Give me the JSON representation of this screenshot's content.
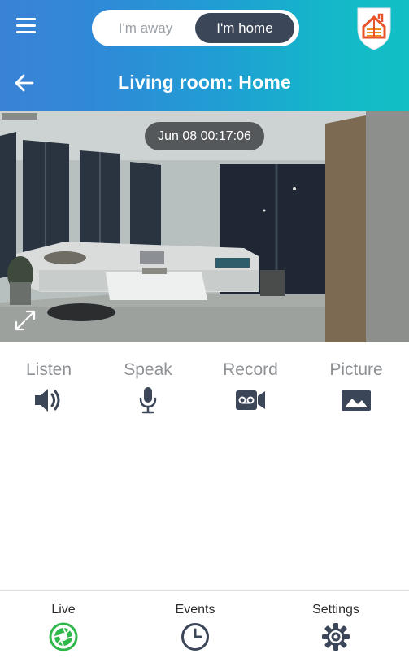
{
  "header": {
    "mode_toggle": {
      "away_label": "I'm away",
      "home_label": "I'm home",
      "selected": "home"
    },
    "title": "Living room: Home",
    "colors": {
      "gradient_start": "#3a82d6",
      "gradient_end": "#12bfc4",
      "toggle_active": "#3c4659"
    }
  },
  "camera": {
    "timestamp": "Jun 08 00:17:06"
  },
  "actions": [
    {
      "label": "Listen",
      "icon": "speaker-icon"
    },
    {
      "label": "Speak",
      "icon": "microphone-icon"
    },
    {
      "label": "Record",
      "icon": "record-icon"
    },
    {
      "label": "Picture",
      "icon": "picture-icon"
    }
  ],
  "bottom_nav": {
    "items": [
      {
        "label": "Live",
        "icon": "camera-aperture-icon",
        "active": true
      },
      {
        "label": "Events",
        "icon": "clock-icon",
        "active": false
      },
      {
        "label": "Settings",
        "icon": "gear-icon",
        "active": false
      }
    ],
    "active_color": "#2fb84a"
  }
}
